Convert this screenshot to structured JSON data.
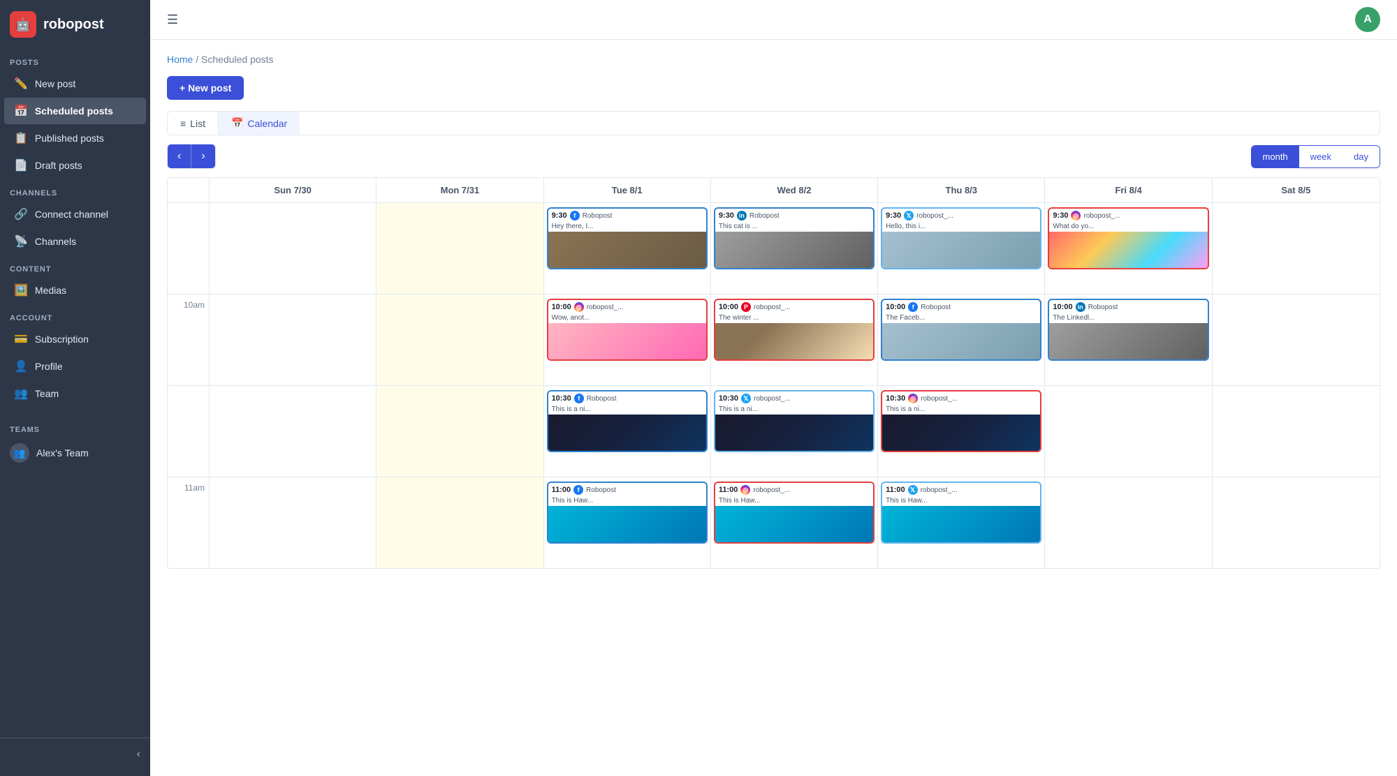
{
  "app": {
    "name": "robopost",
    "logo_char": "🤖"
  },
  "user": {
    "avatar": "A",
    "avatar_bg": "#38a169"
  },
  "sidebar": {
    "sections": [
      {
        "label": "POSTS",
        "items": [
          {
            "id": "new-post",
            "label": "New post",
            "icon": "✏️",
            "active": false
          },
          {
            "id": "scheduled-posts",
            "label": "Scheduled posts",
            "icon": "📅",
            "active": true
          },
          {
            "id": "published-posts",
            "label": "Published posts",
            "icon": "📋",
            "active": false
          },
          {
            "id": "draft-posts",
            "label": "Draft posts",
            "icon": "📄",
            "active": false
          }
        ]
      },
      {
        "label": "CHANNELS",
        "items": [
          {
            "id": "connect-channel",
            "label": "Connect channel",
            "icon": "🔗",
            "active": false
          },
          {
            "id": "channels",
            "label": "Channels",
            "icon": "📡",
            "active": false
          }
        ]
      },
      {
        "label": "CONTENT",
        "items": [
          {
            "id": "medias",
            "label": "Medias",
            "icon": "🖼️",
            "active": false
          }
        ]
      },
      {
        "label": "ACCOUNT",
        "items": [
          {
            "id": "subscription",
            "label": "Subscription",
            "icon": "💳",
            "active": false
          },
          {
            "id": "profile",
            "label": "Profile",
            "icon": "👤",
            "active": false
          },
          {
            "id": "team",
            "label": "Team",
            "icon": "👥",
            "active": false
          }
        ]
      }
    ],
    "teams_label": "TEAMS",
    "team_name": "Alex's Team"
  },
  "breadcrumb": {
    "home": "Home",
    "current": "Scheduled posts"
  },
  "toolbar": {
    "new_post_label": "+ New post",
    "tabs": [
      {
        "id": "list",
        "label": "List",
        "icon": "≡",
        "active": false
      },
      {
        "id": "calendar",
        "label": "Calendar",
        "icon": "📅",
        "active": true
      }
    ]
  },
  "calendar": {
    "prev_label": "‹",
    "next_label": "›",
    "view_modes": [
      {
        "id": "month",
        "label": "month",
        "active": true
      },
      {
        "id": "week",
        "label": "week",
        "active": false
      },
      {
        "id": "day",
        "label": "day",
        "active": false
      }
    ],
    "header_cols": [
      {
        "label": ""
      },
      {
        "label": "Sun 7/30"
      },
      {
        "label": "Mon 7/31"
      },
      {
        "label": "Tue 8/1"
      },
      {
        "label": "Wed 8/2"
      },
      {
        "label": "Thu 8/3"
      },
      {
        "label": "Fri 8/4"
      },
      {
        "label": "Sat 8/5"
      }
    ],
    "rows": [
      {
        "time": "",
        "cells": [
          {
            "today": false,
            "posts": []
          },
          {
            "today": true,
            "posts": []
          },
          {
            "today": false,
            "posts": [
              {
                "time": "9:30",
                "platform": "fb",
                "account": "Robopost",
                "text": "Hey there, I...",
                "img": "cat1"
              },
              {
                "time": "10:00",
                "platform": "ig",
                "account": "robopost_...",
                "text": "Wow, anot...",
                "img": "cat4"
              },
              {
                "time": "10:30",
                "platform": "fb",
                "account": "Robopost",
                "text": "This is a ni...",
                "img": "city"
              },
              {
                "time": "11:00",
                "platform": "fb",
                "account": "Robopost",
                "text": "This is Haw...",
                "img": "beach"
              }
            ]
          },
          {
            "today": false,
            "posts": [
              {
                "time": "9:30",
                "platform": "li",
                "account": "Robopost",
                "text": "This cat is ...",
                "img": "cat2"
              },
              {
                "time": "10:00",
                "platform": "pi",
                "account": "robopost_...",
                "text": "The winter ...",
                "img": "cat5"
              },
              {
                "time": "10:30",
                "platform": "tw",
                "account": "robopost_...",
                "text": "This is a ni...",
                "img": "city"
              },
              {
                "time": "11:00",
                "platform": "ig",
                "account": "robopost_...",
                "text": "This is Haw...",
                "img": "beach"
              }
            ]
          },
          {
            "today": false,
            "posts": [
              {
                "time": "9:30",
                "platform": "tw",
                "account": "robopost_...",
                "text": "Hello, this i...",
                "img": "cat3"
              },
              {
                "time": "10:00",
                "platform": "fb",
                "account": "Robopost",
                "text": "The Faceb...",
                "img": "cat3"
              },
              {
                "time": "10:30",
                "platform": "ig",
                "account": "robopost_...",
                "text": "This is a ni...",
                "img": "city"
              },
              {
                "time": "11:00",
                "platform": "tw",
                "account": "robopost_...",
                "text": "This is Haw...",
                "img": "beach"
              }
            ]
          },
          {
            "today": false,
            "posts": [
              {
                "time": "9:30",
                "platform": "ig",
                "account": "robopost_...",
                "text": "What do yo...",
                "img": "colorful"
              },
              {
                "time": "10:00",
                "platform": "li",
                "account": "Robopost",
                "text": "The Linkedl...",
                "img": "cat2"
              }
            ]
          },
          {
            "today": false,
            "posts": []
          }
        ]
      }
    ],
    "time_rows": [
      {
        "label": "10am"
      },
      {
        "label": ""
      },
      {
        "label": ""
      },
      {
        "label": "11am"
      }
    ]
  }
}
